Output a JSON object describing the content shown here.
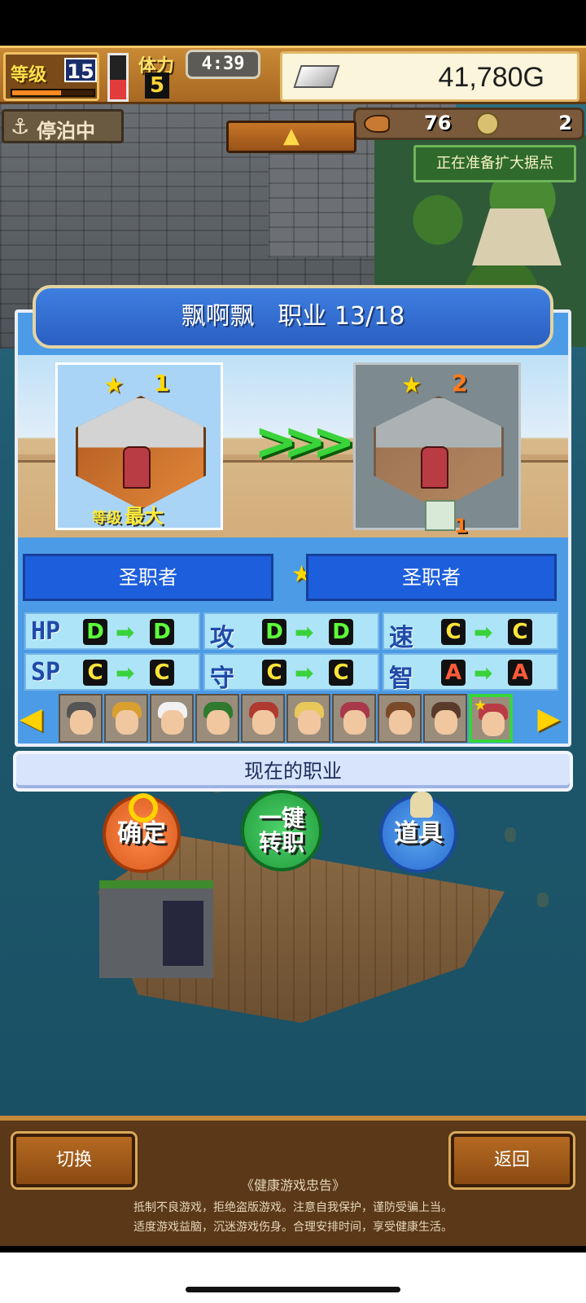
{
  "hud": {
    "level_label": "等级",
    "level_value": "15",
    "level_progress": 0.6,
    "stamina_label": "体力",
    "stamina_value": "5",
    "stamina_level": 0.45,
    "clock": "4:39",
    "gold": "41,780G",
    "status_label": "停泊中",
    "food_count": "76",
    "coin_count": "2",
    "notice": "正在准备扩大据点"
  },
  "panel": {
    "title_name": "飘啊飘",
    "title_job_label": "职业",
    "title_count": "13/18",
    "current_rank": "1",
    "next_rank": "2",
    "level_tag": "等级",
    "level_tag_value": "最大",
    "brush_count": "1",
    "current_job": "圣职者",
    "next_job": "圣职者",
    "stats": [
      {
        "name": "HP",
        "from": "D",
        "to": "D"
      },
      {
        "name": "攻",
        "from": "D",
        "to": "D"
      },
      {
        "name": "速",
        "from": "C",
        "to": "C"
      },
      {
        "name": "SP",
        "from": "C",
        "to": "C"
      },
      {
        "name": "守",
        "from": "C",
        "to": "C"
      },
      {
        "name": "智",
        "from": "A",
        "to": "A"
      }
    ],
    "portrait_count": 10,
    "selected_portrait": 9,
    "current_job_label": "现在的职业"
  },
  "actions": {
    "confirm": "确定",
    "one_key_line1": "一键",
    "one_key_line2": "转职",
    "items": "道具"
  },
  "bottom": {
    "switch_label": "切换",
    "back_label": "返回",
    "advice_title": "《健康游戏忠告》",
    "advice_line1": "抵制不良游戏，拒绝盗版游戏。注意自我保护，谨防受骗上当。",
    "advice_line2": "适度游戏益脑，沉迷游戏伤身。合理安排时间，享受健康生活。",
    "up_arrow": "▲"
  },
  "colors": {
    "panel_blue": "#4c9be6",
    "job_blue": "#1d5edc",
    "grade_D": "#5dff3a",
    "grade_C": "#ffe43a",
    "grade_A": "#ff5a3a",
    "selected_border": "#36d63a"
  }
}
